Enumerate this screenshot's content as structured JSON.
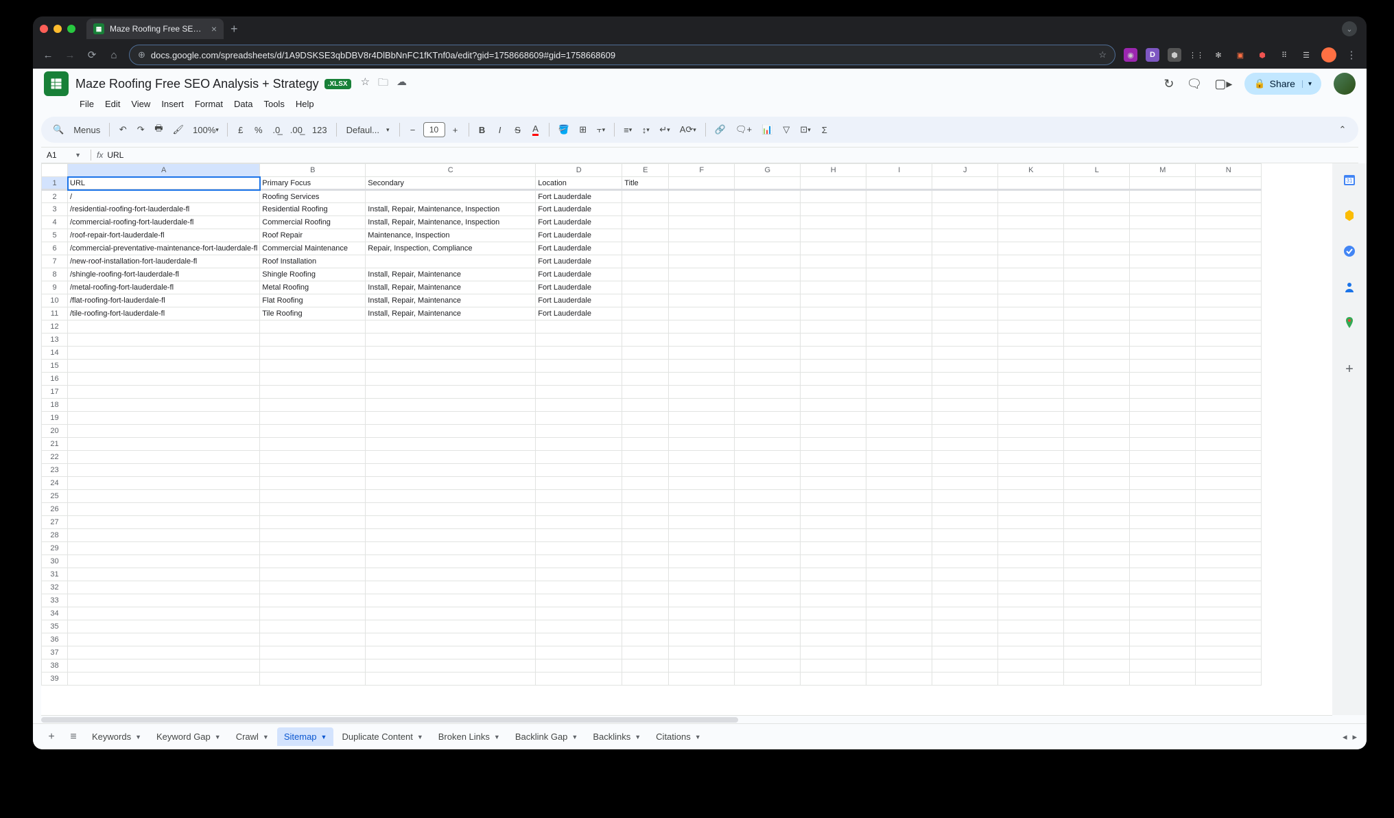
{
  "browser": {
    "tab_title": "Maze Roofing Free SEO Analy",
    "url_display": "docs.google.com/spreadsheets/d/1A9DSKSE3qbDBV8r4DlBbNnFC1fKTnf0a/edit?gid=1758668609#gid=1758668609"
  },
  "doc": {
    "title": "Maze Roofing Free SEO Analysis + Strategy",
    "badge": ".XLSX",
    "menus": [
      "File",
      "Edit",
      "View",
      "Insert",
      "Format",
      "Data",
      "Tools",
      "Help"
    ],
    "share_label": "Share"
  },
  "toolbar": {
    "search_label": "Menus",
    "zoom": "100%",
    "currency": "£",
    "percent": "%",
    "format_123": "123",
    "font": "Defaul...",
    "font_size": "10"
  },
  "namebox": {
    "cell": "A1",
    "formula": "URL"
  },
  "columns": [
    "A",
    "B",
    "C",
    "D",
    "E",
    "F",
    "G",
    "H",
    "I",
    "J",
    "K",
    "L",
    "M",
    "N"
  ],
  "rows_total": 39,
  "headers": {
    "A": "URL",
    "B": "Primary Focus",
    "C": "Secondary",
    "D": "Location",
    "E": "Title"
  },
  "data": [
    {
      "A": "/",
      "B": "Roofing Services",
      "C": "",
      "D": "Fort Lauderdale"
    },
    {
      "A": "/residential-roofing-fort-lauderdale-fl",
      "B": "Residential Roofing",
      "C": "Install, Repair, Maintenance, Inspection",
      "D": "Fort Lauderdale"
    },
    {
      "A": "/commercial-roofing-fort-lauderdale-fl",
      "B": "Commercial Roofing",
      "C": "Install, Repair, Maintenance, Inspection",
      "D": "Fort Lauderdale"
    },
    {
      "A": "/roof-repair-fort-lauderdale-fl",
      "B": "Roof Repair",
      "C": "Maintenance, Inspection",
      "D": "Fort Lauderdale"
    },
    {
      "A": "/commercial-preventative-maintenance-fort-lauderdale-fl",
      "B": "Commercial Maintenance",
      "C": "Repair, Inspection, Compliance",
      "D": "Fort Lauderdale"
    },
    {
      "A": "/new-roof-installation-fort-lauderdale-fl",
      "B": "Roof Installation",
      "C": "",
      "D": "Fort Lauderdale"
    },
    {
      "A": "/shingle-roofing-fort-lauderdale-fl",
      "B": "Shingle Roofing",
      "C": "Install, Repair, Maintenance",
      "D": "Fort Lauderdale"
    },
    {
      "A": "/metal-roofing-fort-lauderdale-fl",
      "B": "Metal Roofing",
      "C": "Install, Repair, Maintenance",
      "D": "Fort Lauderdale"
    },
    {
      "A": "/flat-roofing-fort-lauderdale-fl",
      "B": "Flat Roofing",
      "C": "Install, Repair, Maintenance",
      "D": "Fort Lauderdale"
    },
    {
      "A": "/tile-roofing-fort-lauderdale-fl",
      "B": "Tile Roofing",
      "C": "Install, Repair, Maintenance",
      "D": "Fort Lauderdale"
    }
  ],
  "sheet_tabs": [
    "Keywords",
    "Keyword Gap",
    "Crawl",
    "Sitemap",
    "Duplicate Content",
    "Broken Links",
    "Backlink Gap",
    "Backlinks",
    "Citations"
  ],
  "active_tab": "Sitemap"
}
